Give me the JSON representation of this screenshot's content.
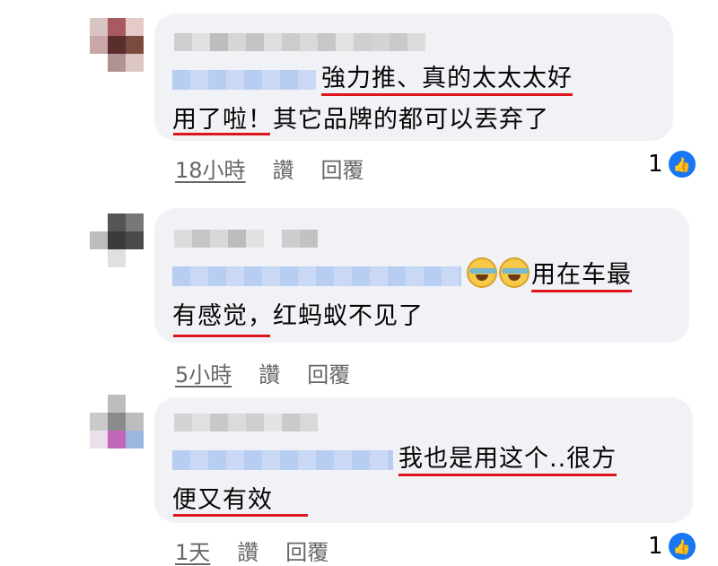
{
  "comments": [
    {
      "lines": [
        "強力推、真的太太太好",
        "用了啦！其它品牌的都可以丟弃了"
      ],
      "time": "18小時",
      "like_label": "讚",
      "reply_label": "回覆",
      "like_count": "1"
    },
    {
      "lines": [
        "用在车最",
        "有感觉，红蚂蚁不见了"
      ],
      "time": "5小時",
      "like_label": "讚",
      "reply_label": "回覆"
    },
    {
      "lines": [
        "我也是用这个..很方",
        "便又有效"
      ],
      "time": "1天",
      "like_label": "讚",
      "reply_label": "回覆",
      "like_count": "1"
    }
  ],
  "colors": {
    "underline": "#e0141e",
    "bubble": "#f0f2f5",
    "meta": "#65676b",
    "like": "#1877f2"
  },
  "icons": {
    "reaction": "like-thumb-icon",
    "emoji": "tears-of-joy-emoji"
  }
}
